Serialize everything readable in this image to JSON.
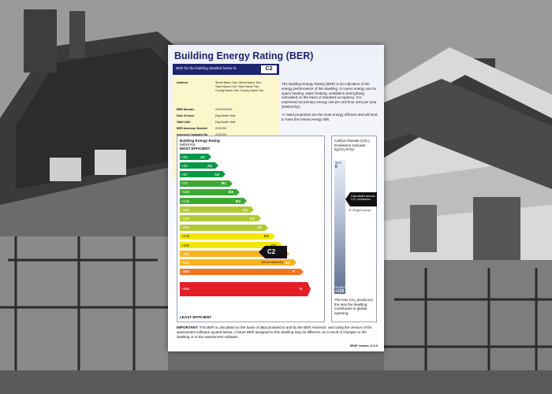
{
  "certificate": {
    "title": "Building Energy Rating (BER)",
    "ber_bar_label": "BER for the building detailed below is:",
    "ber_value": "C2",
    "details": {
      "address_label": "Address",
      "address_lines": [
        "Street Name One, Street Name Two,",
        "Town Name One, Town Name Two,",
        "County Name One, County Name Two"
      ],
      "rows": [
        {
          "label": "BER Number",
          "value": "XXXXXXXXX"
        },
        {
          "label": "Date of Issue",
          "value": "Day   Month   Year"
        },
        {
          "label": "Valid Until",
          "value": "Day   Month   Year"
        },
        {
          "label": "BER Assessor Number",
          "value": "XXXXXX"
        },
        {
          "label": "Assessor Company No",
          "value": "XXXXXX"
        }
      ]
    },
    "description": [
      "The Building Energy Rating (BER) is an indication of the energy performance of this dwelling. It covers energy use for space heating, water heating, ventilation and lighting, calculated on the basis of standard occupancy. It is expressed as primary energy use per unit floor area per year (kWh/m²/yr).",
      "‘A’ rated properties are the most energy efficient and will tend to have the lowest energy bills."
    ]
  },
  "rating": {
    "title": "Building Energy Rating",
    "unit": "kWh/m²/yr",
    "most_efficient": "MOST EFFICIENT",
    "least_efficient": "LEAST EFFICIENT",
    "bands": [
      {
        "range": "<25",
        "grade": "A1",
        "color": "#009a44"
      },
      {
        "range": ">25",
        "grade": "A2",
        "color": "#009a44"
      },
      {
        "range": ">50",
        "grade": "A3",
        "color": "#009a44"
      },
      {
        "range": ">75",
        "grade": "B1",
        "color": "#3aaa35"
      },
      {
        "range": ">100",
        "grade": "B2",
        "color": "#3aaa35"
      },
      {
        "range": ">125",
        "grade": "B3",
        "color": "#3aaa35"
      },
      {
        "range": ">150",
        "grade": "C1",
        "color": "#b2c936"
      },
      {
        "range": ">175",
        "grade": "C2",
        "color": "#b2c936"
      },
      {
        "range": ">200",
        "grade": "C3",
        "color": "#b2c936"
      },
      {
        "range": ">225",
        "grade": "D1",
        "color": "#f3e600"
      },
      {
        "range": ">260",
        "grade": "D2",
        "color": "#f3e600"
      },
      {
        "range": ">300",
        "grade": "E1",
        "color": "#f8b322"
      },
      {
        "range": ">340",
        "grade": "E2",
        "color": "#f8b322"
      },
      {
        "range": ">380",
        "grade": "F",
        "color": "#ee7623"
      },
      {
        "range": ">450",
        "grade": "G",
        "color": "#e31e24"
      }
    ],
    "marker_grade": "C2",
    "marker_value": "186.69 kWh/m²/yr"
  },
  "co2": {
    "title": "Carbon Dioxide (CO₂) Emissions Indicator",
    "unit": "kgCO₂/m²/yr",
    "best_label": "BEST",
    "best_value": "0",
    "worst_label": "WORST",
    "worst_value": ">120",
    "arrow_text": "Calculated annual CO₂ emissions",
    "value": "37.78 kgCO₂/m²/yr",
    "note": "The less CO₂ produced, the less the dwelling contributes to global warming."
  },
  "footer": {
    "important_label": "IMPORTANT:",
    "important_text": "This BER is calculated on the basis of data provided to and by the BER Assessor, and using the version of the assessment software quoted below. A future BER assigned to this dwelling may be different, as a result of changes to the dwelling or to the assessment software.",
    "version": "DEAP Version: X.X.X"
  }
}
